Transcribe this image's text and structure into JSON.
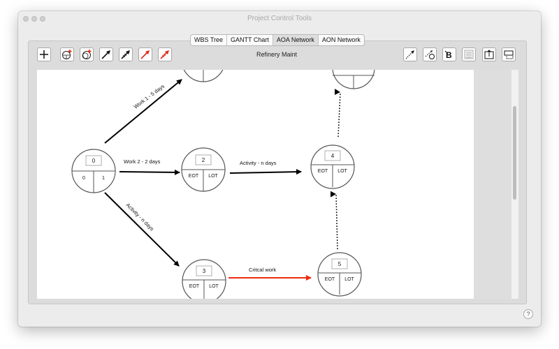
{
  "window": {
    "title": "Project Control Tools"
  },
  "tabs": [
    {
      "label": "WBS Tree"
    },
    {
      "label": "GANTT Chart"
    },
    {
      "label": "AOA Network"
    },
    {
      "label": "AON Network"
    }
  ],
  "active_tab": "AOA Network",
  "document": {
    "title": "Refinery Maint"
  },
  "toolbar": {
    "left_tools": [
      "plus-icon",
      "add-node-icon",
      "add-grouped-node-icon",
      "black-arrow-icon",
      "black-arrow-hatched-icon",
      "red-arrow-icon",
      "red-arrow-hatched-icon"
    ],
    "right_tools": [
      "dotted-arrow-icon",
      "dummy-link-icon",
      "text-tool-icon",
      "list-icon",
      "export-icon",
      "layout-icon"
    ]
  },
  "network": {
    "nodes": [
      {
        "id": "0",
        "left": "0",
        "right": "1"
      },
      {
        "id": "2",
        "left": "EOT",
        "right": "LOT"
      },
      {
        "id": "3",
        "left": "EOT",
        "right": "LOT"
      },
      {
        "id": "4",
        "left": "EOT",
        "right": "LOT"
      },
      {
        "id": "5",
        "left": "EOT",
        "right": "LOT"
      },
      {
        "id": "1",
        "left": "",
        "right": ""
      },
      {
        "id": "6",
        "left": "",
        "right": ""
      }
    ],
    "activities": [
      {
        "label": "Work 1 - 5 days",
        "from": "0",
        "to": "1",
        "style": "solid",
        "color": "#000000"
      },
      {
        "label": "Work 2 - 2 days",
        "from": "0",
        "to": "2",
        "style": "solid",
        "color": "#000000"
      },
      {
        "label": "Activity - n days",
        "from": "0",
        "to": "3",
        "style": "solid",
        "color": "#000000"
      },
      {
        "label": "Activity - n days",
        "from": "2",
        "to": "4",
        "style": "solid",
        "color": "#000000"
      },
      {
        "label": "Critcal work",
        "from": "3",
        "to": "5",
        "style": "solid",
        "color": "#ee2a12"
      },
      {
        "label": "",
        "from": "5",
        "to": "4",
        "style": "dotted",
        "color": "#000000"
      },
      {
        "label": "",
        "from": "4",
        "to": "6",
        "style": "dotted",
        "color": "#000000"
      }
    ]
  },
  "help": {
    "label": "?"
  }
}
